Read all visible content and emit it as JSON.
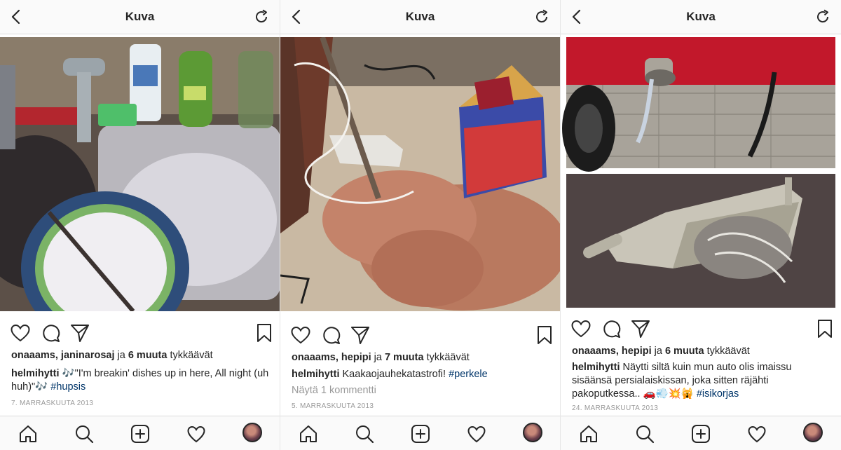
{
  "screens": [
    {
      "header": {
        "title": "Kuva"
      },
      "likes": {
        "users": "onaaams, janinarosaj",
        "mid": " ja ",
        "others": "6 muuta",
        "suffix": " tykkäävät"
      },
      "caption": {
        "user": "helmihytti",
        "text": " 🎶\"I'm breakin' dishes up in here, All night (uh huh)\"🎶 ",
        "tag": "#hupsis"
      },
      "comments": "",
      "date": "7. MARRASKUUTA 2013",
      "photo_subject": "dishes in sink"
    },
    {
      "header": {
        "title": "Kuva"
      },
      "likes": {
        "users": "onaaams, hepipi",
        "mid": " ja ",
        "others": "7 muuta",
        "suffix": " tykkäävät"
      },
      "caption": {
        "user": "helmihytti",
        "text": " Kaakaojauhekatastrofi! ",
        "tag": "#perkele"
      },
      "comments": "Näytä 1 kommentti",
      "date": "5. MARRASKUUTA 2013",
      "photo_subject": "spilled cocoa powder"
    },
    {
      "header": {
        "title": "Kuva"
      },
      "likes": {
        "users": "onaaams, hepipi",
        "mid": " ja ",
        "others": "6 muuta",
        "suffix": " tykkäävät"
      },
      "caption": {
        "user": "helmihytti",
        "text": " Näytti siltä kuin mun auto olis imaissu sisäänsä persialaiskissan, joka sitten räjähti pakoputkessa.. 🚗💨💥🙀 ",
        "tag": "#isikorjas"
      },
      "comments": "",
      "date": "24. MARRASKUUTA 2013",
      "photo_subject": "car exhaust with cat hair"
    }
  ],
  "icons": {
    "header_left": "back-chevron-icon",
    "header_right": "refresh-icon",
    "actions": [
      "heart-icon",
      "comment-icon",
      "share-icon",
      "bookmark-icon"
    ],
    "tabs": [
      "home-icon",
      "search-icon",
      "add-post-icon",
      "activity-heart-icon",
      "profile-avatar"
    ]
  },
  "colors": {
    "text": "#262626",
    "hashtag": "#003569",
    "muted": "#999999",
    "border": "#dbdbdb"
  }
}
